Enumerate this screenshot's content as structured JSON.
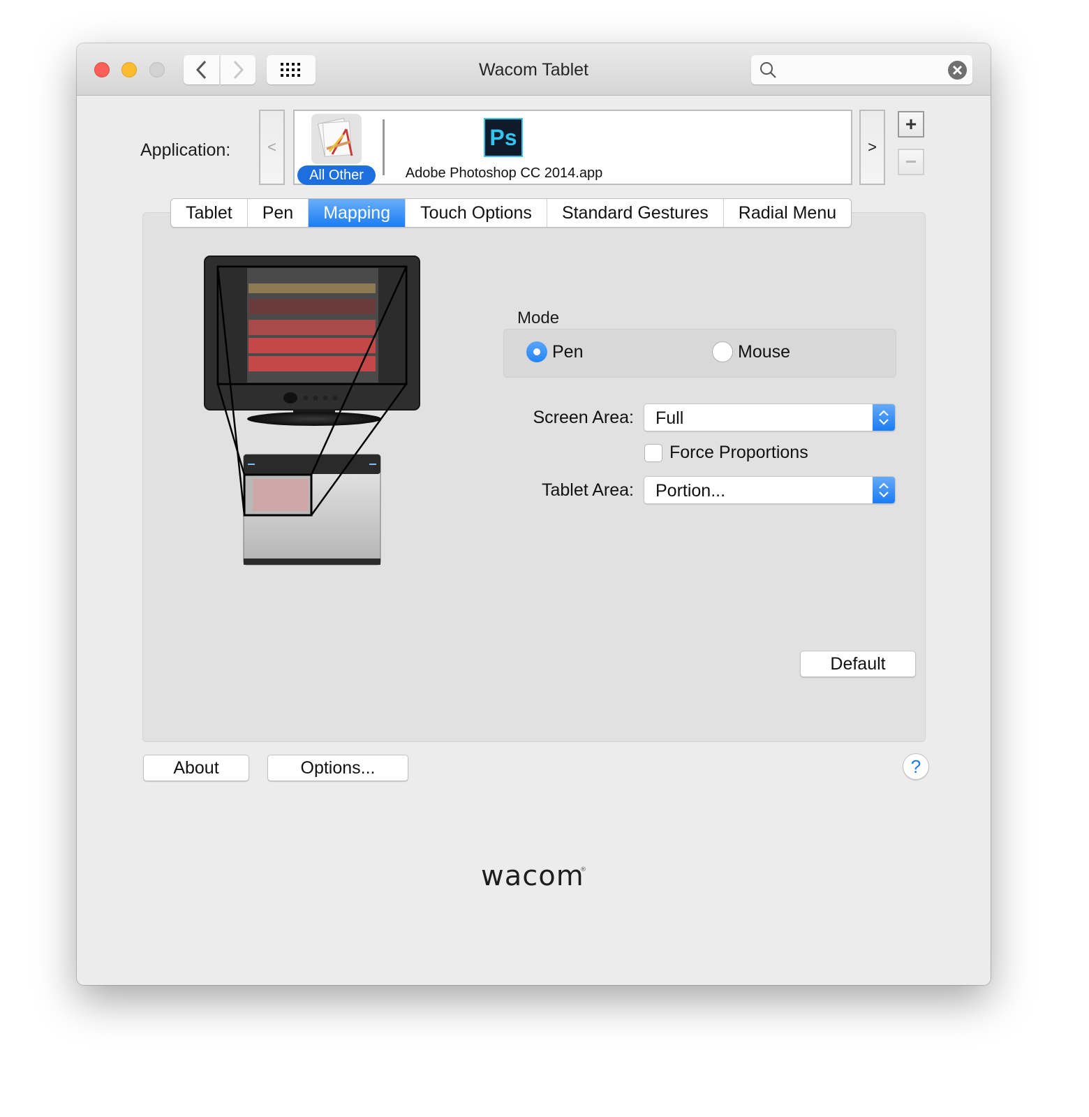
{
  "window": {
    "title": "Wacom Tablet",
    "search": {
      "value": "",
      "placeholder": ""
    }
  },
  "toolbar": {
    "back_icon": "chevron-left-icon",
    "forward_icon": "chevron-right-icon",
    "grid_icon": "show-all-grid-icon"
  },
  "application": {
    "label": "Application:",
    "prev_label": "<",
    "next_label": ">",
    "add_label": "+",
    "remove_label": "−",
    "items": [
      {
        "label": "All Other",
        "icon": "all-other-applications-icon",
        "selected": true
      },
      {
        "label": "Adobe Photoshop CC 2014.app",
        "icon": "photoshop-icon",
        "icon_text": "Ps",
        "selected": false
      }
    ]
  },
  "tabs": [
    {
      "label": "Tablet",
      "active": false
    },
    {
      "label": "Pen",
      "active": false
    },
    {
      "label": "Mapping",
      "active": true
    },
    {
      "label": "Touch Options",
      "active": false
    },
    {
      "label": "Standard Gestures",
      "active": false
    },
    {
      "label": "Radial Menu",
      "active": false
    }
  ],
  "mapping": {
    "mode": {
      "label": "Mode",
      "options": [
        {
          "label": "Pen",
          "selected": true
        },
        {
          "label": "Mouse",
          "selected": false
        }
      ]
    },
    "screen_area": {
      "label": "Screen Area:",
      "value": "Full"
    },
    "force_proportions": {
      "label": "Force Proportions",
      "checked": false
    },
    "tablet_area": {
      "label": "Tablet Area:",
      "value": "Portion..."
    },
    "default_label": "Default"
  },
  "footer": {
    "about_label": "About",
    "options_label": "Options...",
    "help_label": "?",
    "brand": "wacom",
    "brand_mark": "®"
  },
  "colors": {
    "accent": "#1a7df5",
    "close": "#fc5f57",
    "minimize": "#fdbc2e",
    "zoom": "#d2d2d2",
    "panel": "#e1e1e1",
    "window": "#ececec"
  }
}
